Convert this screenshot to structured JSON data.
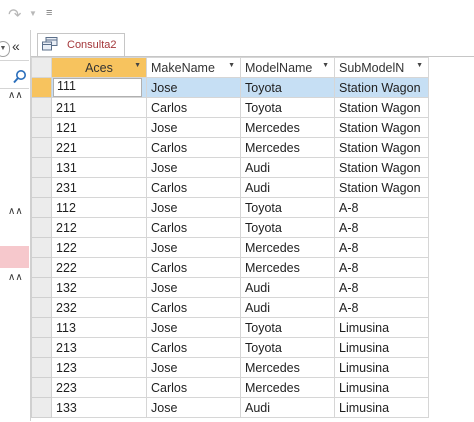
{
  "object_tab": {
    "label": "Consulta2"
  },
  "columns": [
    {
      "name": "aces-header",
      "label": "Aces"
    },
    {
      "name": "makename-header",
      "label": "MakeName"
    },
    {
      "name": "modelname-header",
      "label": "ModelName"
    },
    {
      "name": "submodelname-header",
      "label": "SubModelN"
    }
  ],
  "rows": [
    [
      "111",
      "Jose",
      "Toyota",
      "Station Wagon"
    ],
    [
      "211",
      "Carlos",
      "Toyota",
      "Station Wagon"
    ],
    [
      "121",
      "Jose",
      "Mercedes",
      "Station Wagon"
    ],
    [
      "221",
      "Carlos",
      "Mercedes",
      "Station Wagon"
    ],
    [
      "131",
      "Jose",
      "Audi",
      "Station Wagon"
    ],
    [
      "231",
      "Carlos",
      "Audi",
      "Station Wagon"
    ],
    [
      "112",
      "Jose",
      "Toyota",
      "A-8"
    ],
    [
      "212",
      "Carlos",
      "Toyota",
      "A-8"
    ],
    [
      "122",
      "Jose",
      "Mercedes",
      "A-8"
    ],
    [
      "222",
      "Carlos",
      "Mercedes",
      "A-8"
    ],
    [
      "132",
      "Jose",
      "Audi",
      "A-8"
    ],
    [
      "232",
      "Carlos",
      "Audi",
      "A-8"
    ],
    [
      "113",
      "Jose",
      "Toyota",
      "Limusina"
    ],
    [
      "213",
      "Carlos",
      "Toyota",
      "Limusina"
    ],
    [
      "123",
      "Jose",
      "Mercedes",
      "Limusina"
    ],
    [
      "223",
      "Carlos",
      "Mercedes",
      "Limusina"
    ],
    [
      "133",
      "Jose",
      "Audi",
      "Limusina"
    ]
  ],
  "selected_row_index": 0,
  "colors": {
    "accent": "#a4373a",
    "sorted_header": "#f7c35e",
    "selected_row": "#c6dff4",
    "nav_selected": "#f6c8cc"
  }
}
